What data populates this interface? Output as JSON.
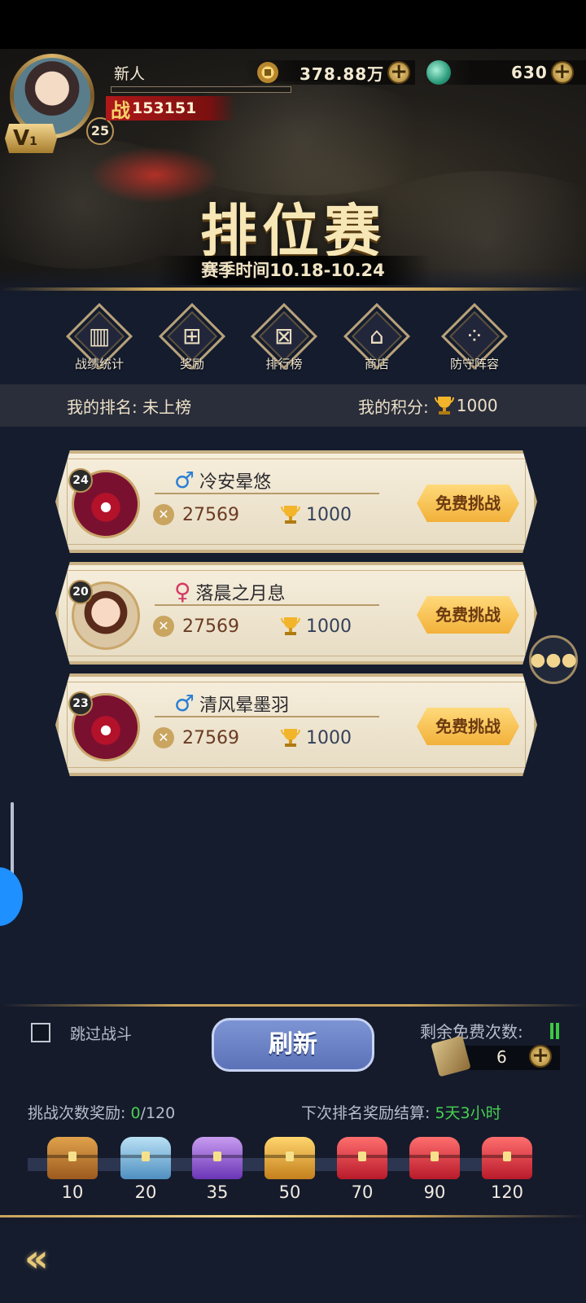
{
  "header": {
    "player_name": "新人",
    "vip_prefix": "V",
    "vip_level": "1",
    "player_level": "25",
    "power_label": "战",
    "power_value": "153151",
    "exp_progress": 0,
    "coins": "378.88万",
    "jade": "630"
  },
  "title": {
    "main": "排位赛",
    "season": "赛季时间10.18-10.24"
  },
  "menu": [
    {
      "label": "战绩统计",
      "icon": "stats-icon"
    },
    {
      "label": "奖励",
      "icon": "gift-icon"
    },
    {
      "label": "排行榜",
      "icon": "leaderboard-icon"
    },
    {
      "label": "商店",
      "icon": "shop-icon"
    },
    {
      "label": "防守阵容",
      "icon": "formation-icon"
    }
  ],
  "rank_bar": {
    "my_rank_label": "我的排名: 未上榜",
    "my_score_label": "我的积分:",
    "my_score": "1000"
  },
  "opponents": [
    {
      "level": "24",
      "gender": "male",
      "gender_symbol": "♂",
      "name": "冷安晕悠",
      "power": "27569",
      "trophies": "1000",
      "button": "免费挑战"
    },
    {
      "level": "20",
      "gender": "female",
      "gender_symbol": "♀",
      "name": "落晨之月息",
      "power": "27569",
      "trophies": "1000",
      "button": "免费挑战"
    },
    {
      "level": "23",
      "gender": "male",
      "gender_symbol": "♂",
      "name": "清风晕墨羽",
      "power": "27569",
      "trophies": "1000",
      "button": "免费挑战"
    }
  ],
  "bottom": {
    "skip_battle": "跳过战斗",
    "refresh": "刷新",
    "free_remaining_label": "剩余免费次数:",
    "tickets": "6",
    "challenge_reward_label": "挑战次数奖励:",
    "challenge_current": "0",
    "challenge_total": "/120",
    "next_settle_label": "下次排名奖励结算:",
    "next_settle_time": "5天3小时",
    "chests": [
      {
        "count": "10",
        "type": "wood"
      },
      {
        "count": "20",
        "type": "silver"
      },
      {
        "count": "35",
        "type": "purple"
      },
      {
        "count": "50",
        "type": "gold"
      },
      {
        "count": "70",
        "type": "red"
      },
      {
        "count": "90",
        "type": "red"
      },
      {
        "count": "120",
        "type": "red"
      }
    ]
  },
  "colors": {
    "background": "#141c2e",
    "gold_accent": "#c9a35a",
    "challenge_button": "#f2b13a",
    "refresh_button": "#6b82c6",
    "highlight_green": "#46d150"
  }
}
